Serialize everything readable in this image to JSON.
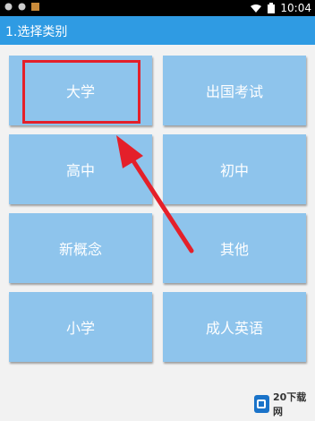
{
  "status_bar": {
    "time": "10:04"
  },
  "app_bar": {
    "title": "1.选择类别"
  },
  "categories": [
    {
      "label": "大学"
    },
    {
      "label": "出国考试"
    },
    {
      "label": "高中"
    },
    {
      "label": "初中"
    },
    {
      "label": "新概念"
    },
    {
      "label": "其他"
    },
    {
      "label": "小学"
    },
    {
      "label": "成人英语"
    }
  ],
  "colors": {
    "app_bar": "#2f9be3",
    "tile": "#8ec4ec",
    "annotation": "#e4202a"
  }
}
